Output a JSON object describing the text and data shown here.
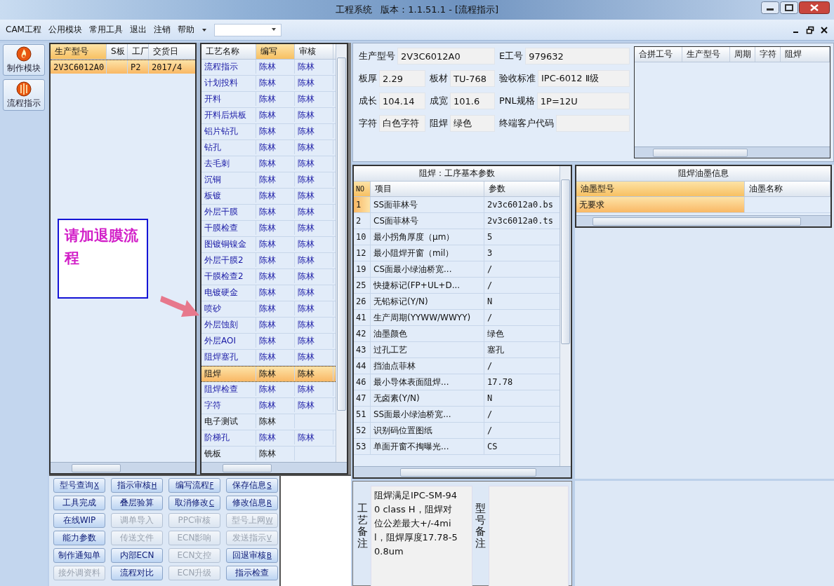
{
  "window": {
    "title": "工程系统   版本：1.1.51.1 - [流程指示]"
  },
  "menu": [
    "CAM工程",
    "公用模块",
    "常用工具",
    "退出",
    "注销",
    "帮助"
  ],
  "nav": [
    {
      "label": "制作模块",
      "kind": "fire"
    },
    {
      "label": "流程指示",
      "kind": "ball"
    }
  ],
  "orders": {
    "columns": [
      {
        "label": "生产型号",
        "sorted": true
      },
      {
        "label": "S板",
        "sorted": false
      },
      {
        "label": "工厂",
        "sorted": false
      },
      {
        "label": "交货日",
        "sorted": false
      }
    ],
    "rows": [
      {
        "model": "2V3C6012A0",
        "factory": "P2",
        "delivery": "2017/4",
        "selected": true
      }
    ]
  },
  "callout": {
    "text": "请加退膜流程"
  },
  "process": {
    "columns": [
      {
        "label": "工艺名称",
        "sorted": false
      },
      {
        "label": "编写",
        "sorted": true
      },
      {
        "label": "审核",
        "sorted": false
      }
    ],
    "rows": [
      {
        "name": "流程指示",
        "writer": "陈林",
        "reviewer": "陈林",
        "selected": false
      },
      {
        "name": "计划投料",
        "writer": "陈林",
        "reviewer": "陈林",
        "selected": false
      },
      {
        "name": "开料",
        "writer": "陈林",
        "reviewer": "陈林",
        "selected": false
      },
      {
        "name": "开料后烘板",
        "writer": "陈林",
        "reviewer": "陈林",
        "selected": false
      },
      {
        "name": "铝片钻孔",
        "writer": "陈林",
        "reviewer": "陈林",
        "selected": false
      },
      {
        "name": "钻孔",
        "writer": "陈林",
        "reviewer": "陈林",
        "selected": false
      },
      {
        "name": "去毛刺",
        "writer": "陈林",
        "reviewer": "陈林",
        "selected": false
      },
      {
        "name": "沉铜",
        "writer": "陈林",
        "reviewer": "陈林",
        "selected": false
      },
      {
        "name": "板镀",
        "writer": "陈林",
        "reviewer": "陈林",
        "selected": false
      },
      {
        "name": "外层干膜",
        "writer": "陈林",
        "reviewer": "陈林",
        "selected": false
      },
      {
        "name": "干膜检查",
        "writer": "陈林",
        "reviewer": "陈林",
        "selected": false
      },
      {
        "name": "图镀铜镍金",
        "writer": "陈林",
        "reviewer": "陈林",
        "selected": false
      },
      {
        "name": "外层干膜2",
        "writer": "陈林",
        "reviewer": "陈林",
        "selected": false
      },
      {
        "name": "干膜检查2",
        "writer": "陈林",
        "reviewer": "陈林",
        "selected": false
      },
      {
        "name": "电镀硬金",
        "writer": "陈林",
        "reviewer": "陈林",
        "selected": false
      },
      {
        "name": "喷砂",
        "writer": "陈林",
        "reviewer": "陈林",
        "selected": false
      },
      {
        "name": "外层蚀刻",
        "writer": "陈林",
        "reviewer": "陈林",
        "selected": false
      },
      {
        "name": "外层AOI",
        "writer": "陈林",
        "reviewer": "陈林",
        "selected": false
      },
      {
        "name": "阻焊塞孔",
        "writer": "陈林",
        "reviewer": "陈林",
        "selected": false
      },
      {
        "name": "阻焊",
        "writer": "陈林",
        "reviewer": "陈林",
        "selected": true
      },
      {
        "name": "阻焊检查",
        "writer": "陈林",
        "reviewer": "陈林",
        "selected": false
      },
      {
        "name": "字符",
        "writer": "陈林",
        "reviewer": "陈林",
        "selected": false
      },
      {
        "name": "电子测试",
        "writer": "陈林",
        "selected": false
      },
      {
        "name": "阶梯孔",
        "writer": "陈林",
        "reviewer": "陈林",
        "selected": false
      },
      {
        "name": "铣板",
        "writer": "陈林",
        "selected": false
      }
    ]
  },
  "buttons": [
    {
      "label": "型号查询",
      "key": "X",
      "disabled": false
    },
    {
      "label": "指示审核",
      "key": "H",
      "disabled": false
    },
    {
      "label": "编写流程",
      "key": "F",
      "disabled": false
    },
    {
      "label": "保存信息",
      "key": "S",
      "disabled": false
    },
    {
      "label": "工具完成",
      "disabled": false
    },
    {
      "label": "叠层验算",
      "disabled": false
    },
    {
      "label": "取消修改",
      "key": "C",
      "disabled": false
    },
    {
      "label": "修改信息",
      "key": "R",
      "disabled": false
    },
    {
      "label": "在线WIP",
      "disabled": false
    },
    {
      "label": "调单导入",
      "disabled": true
    },
    {
      "label": "PPC审核",
      "disabled": true
    },
    {
      "label": "型号上网",
      "key": "W",
      "disabled": true
    },
    {
      "label": "能力参数",
      "disabled": false
    },
    {
      "label": "传送文件",
      "disabled": true
    },
    {
      "label": "ECN影响",
      "disabled": true
    },
    {
      "label": "发送指示",
      "key": "V",
      "disabled": true
    },
    {
      "label": "制作通知单",
      "disabled": false
    },
    {
      "label": "内部ECN",
      "disabled": false
    },
    {
      "label": "ECN文控",
      "disabled": true
    },
    {
      "label": "回退审核",
      "key": "B",
      "disabled": false
    },
    {
      "label": "接外调资料",
      "disabled": true
    },
    {
      "label": "流程对比",
      "disabled": false
    },
    {
      "label": "ECN升级",
      "disabled": true
    },
    {
      "label": "指示检查",
      "disabled": false
    }
  ],
  "info": {
    "rows": [
      {
        "fields": [
          {
            "label": "生产型号",
            "value": "2V3C6012A0"
          },
          {
            "label": "E工号",
            "value": "979632"
          }
        ]
      },
      {
        "fields": [
          {
            "label": "板厚",
            "value": "2.29"
          },
          {
            "label": "板材",
            "value": "TU-768"
          },
          {
            "label": "验收标准",
            "value": "IPC-6012 Ⅱ级"
          }
        ]
      },
      {
        "fields": [
          {
            "label": "成长",
            "value": "104.14"
          },
          {
            "label": "成宽",
            "value": "101.6"
          },
          {
            "label": "PNL规格",
            "value": "1P=12U"
          }
        ]
      },
      {
        "fields": [
          {
            "label": "字符",
            "value": "白色字符"
          },
          {
            "label": "阻焊",
            "value": "绿色"
          },
          {
            "label": "终端客户代码"
          }
        ]
      }
    ]
  },
  "merge": {
    "columns": [
      "合拼工号",
      "生产型号",
      "周期",
      "字符",
      "阻焊"
    ]
  },
  "params": {
    "title": "阻焊：工序基本参数",
    "columns": [
      "NO",
      "项目",
      "参数"
    ],
    "rows": [
      {
        "no": "1",
        "item": "SS面菲林号",
        "value": "2v3c6012a0.bs",
        "selected": true
      },
      {
        "no": "2",
        "item": "CS面菲林号",
        "value": "2v3c6012a0.ts",
        "selected": false
      },
      {
        "no": "10",
        "item": "最小拐角厚度（μm）",
        "value": "5",
        "selected": false
      },
      {
        "no": "12",
        "item": "最小阻焊开窗（mil）",
        "value": "3",
        "selected": false
      },
      {
        "no": "19",
        "item": "CS面最小绿油桥宽...",
        "value": "/",
        "selected": false
      },
      {
        "no": "25",
        "item": "快捷标记(FP+UL+D...",
        "value": "/",
        "selected": false
      },
      {
        "no": "26",
        "item": "无铅标记(Y/N)",
        "value": "N",
        "selected": false
      },
      {
        "no": "41",
        "item": "生产周期(YYWW/WWYY)",
        "value": "/",
        "selected": false
      },
      {
        "no": "42",
        "item": "油墨颜色",
        "value": "绿色",
        "selected": false
      },
      {
        "no": "43",
        "item": "过孔工艺",
        "value": "塞孔",
        "selected": false
      },
      {
        "no": "44",
        "item": "挡油点菲林",
        "value": "/",
        "selected": false
      },
      {
        "no": "46",
        "item": "最小导体表面阻焊...",
        "value": "17.78",
        "selected": false
      },
      {
        "no": "47",
        "item": "无卤素(Y/N)",
        "value": "N",
        "selected": false
      },
      {
        "no": "51",
        "item": "SS面最小绿油桥宽...",
        "value": "/",
        "selected": false
      },
      {
        "no": "52",
        "item": "识别码位置图纸",
        "value": "/",
        "selected": false
      },
      {
        "no": "53",
        "item": "单面开窗不掏曝光...",
        "value": "CS",
        "selected": false
      }
    ]
  },
  "ink": {
    "title": "阻焊油墨信息",
    "columns": [
      {
        "label": "油墨型号",
        "sorted": true
      },
      {
        "label": "油墨名称",
        "sorted": false
      }
    ],
    "rows": [
      {
        "model": "无要求",
        "selected": true
      }
    ]
  },
  "remarks": {
    "process_label": "工艺备注",
    "process_text": "阻焊满足IPC-SM-940 class H，阻焊对位公差最大+/-4mil，阻焊厚度17.78-50.8um",
    "model_label": "型号备注"
  }
}
